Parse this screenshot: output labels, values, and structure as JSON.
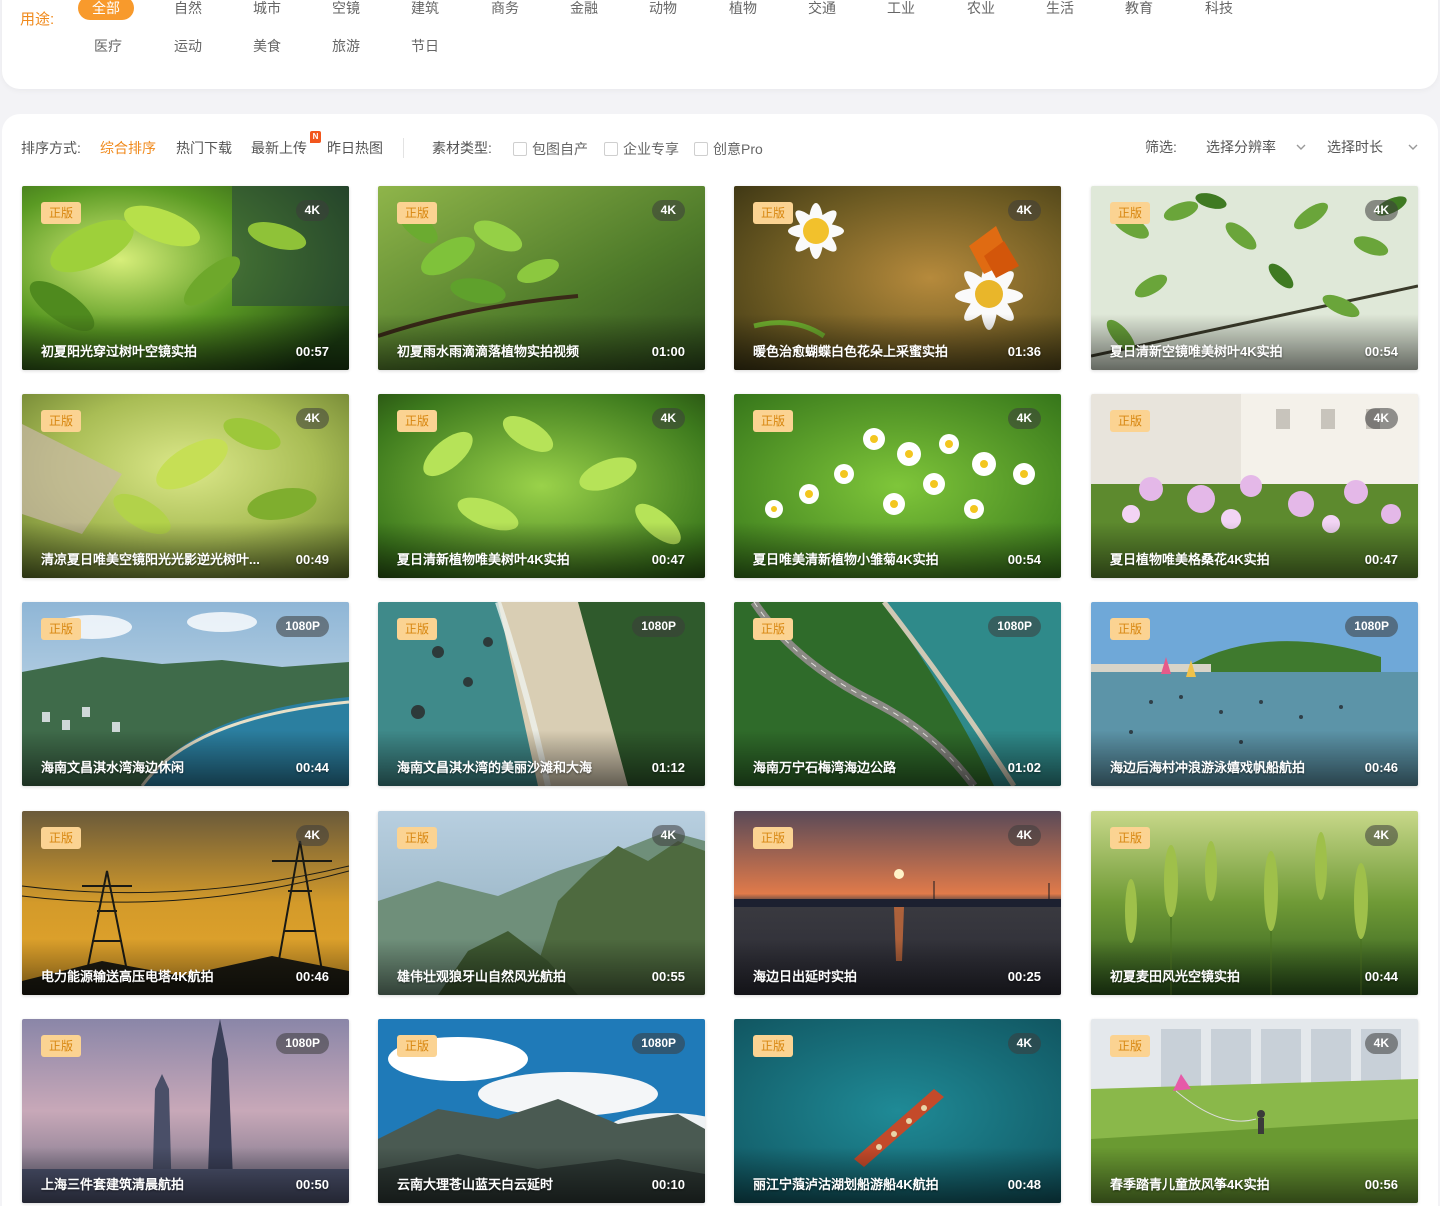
{
  "usage": {
    "label": "用途:",
    "categories": [
      "全部",
      "自然",
      "城市",
      "空镜",
      "建筑",
      "商务",
      "金融",
      "动物",
      "植物",
      "交通",
      "工业",
      "农业",
      "生活",
      "教育",
      "科技",
      "医疗",
      "运动",
      "美食",
      "旅游",
      "节日"
    ],
    "active": "全部"
  },
  "toolbar": {
    "sort_label": "排序方式:",
    "sorts": [
      "综合排序",
      "热门下载",
      "最新上传",
      "昨日热图"
    ],
    "active_sort": "综合排序",
    "new_badge": "N",
    "material_label": "素材类型:",
    "materials": [
      "包图自产",
      "企业专享",
      "创意Pro"
    ],
    "filter_label": "筛选:",
    "resolution_select": "选择分辨率",
    "duration_select": "选择时长"
  },
  "card_badge": "正版",
  "colors": {
    "accent": "#f08a1c",
    "badge_bg": "#fbd392",
    "badge_text": "#d7860f",
    "new_badge": "#f2561d"
  },
  "videos": [
    {
      "title": "初夏阳光穿过树叶空镜实拍",
      "resolution": "4K",
      "duration": "00:57"
    },
    {
      "title": "初夏雨水雨滴滴落植物实拍视频",
      "resolution": "4K",
      "duration": "01:00"
    },
    {
      "title": "暖色治愈蝴蝶白色花朵上采蜜实拍",
      "resolution": "4K",
      "duration": "01:36"
    },
    {
      "title": "夏日清新空镜唯美树叶4K实拍",
      "resolution": "4K",
      "duration": "00:54"
    },
    {
      "title": "清凉夏日唯美空镜阳光光影逆光树叶...",
      "resolution": "4K",
      "duration": "00:49"
    },
    {
      "title": "夏日清新植物唯美树叶4K实拍",
      "resolution": "4K",
      "duration": "00:47"
    },
    {
      "title": "夏日唯美清新植物小雏菊4K实拍",
      "resolution": "4K",
      "duration": "00:54"
    },
    {
      "title": "夏日植物唯美格桑花4K实拍",
      "resolution": "4K",
      "duration": "00:47"
    },
    {
      "title": "海南文昌淇水湾海边休闲",
      "resolution": "1080P",
      "duration": "00:44"
    },
    {
      "title": "海南文昌淇水湾的美丽沙滩和大海",
      "resolution": "1080P",
      "duration": "01:12"
    },
    {
      "title": "海南万宁石梅湾海边公路",
      "resolution": "1080P",
      "duration": "01:02"
    },
    {
      "title": "海边后海村冲浪游泳嬉戏帆船航拍",
      "resolution": "1080P",
      "duration": "00:46"
    },
    {
      "title": "电力能源输送高压电塔4K航拍",
      "resolution": "4K",
      "duration": "00:46"
    },
    {
      "title": "雄伟壮观狼牙山自然风光航拍",
      "resolution": "4K",
      "duration": "00:55"
    },
    {
      "title": "海边日出延时实拍",
      "resolution": "4K",
      "duration": "00:25"
    },
    {
      "title": "初夏麦田风光空镜实拍",
      "resolution": "4K",
      "duration": "00:44"
    },
    {
      "title": "上海三件套建筑清晨航拍",
      "resolution": "1080P",
      "duration": "00:50"
    },
    {
      "title": "云南大理苍山蓝天白云延时",
      "resolution": "1080P",
      "duration": "00:10"
    },
    {
      "title": "丽江宁蒗泸沽湖划船游船4K航拍",
      "resolution": "4K",
      "duration": "00:48"
    },
    {
      "title": "春季踏青儿童放风筝4K实拍",
      "resolution": "4K",
      "duration": "00:56"
    }
  ]
}
